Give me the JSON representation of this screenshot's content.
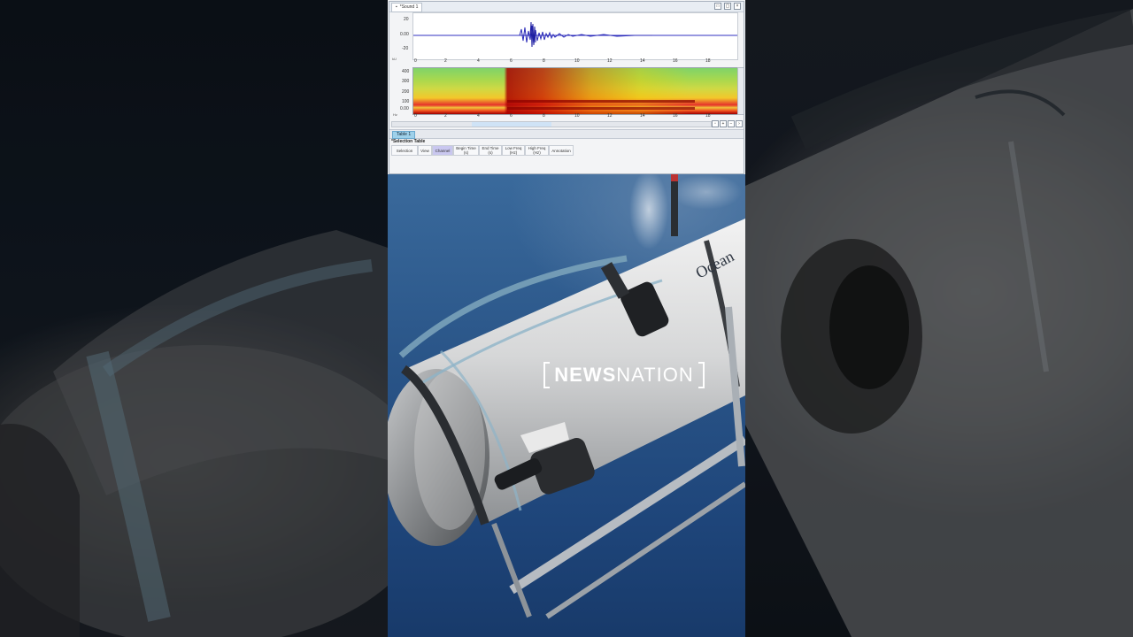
{
  "window": {
    "sound_tab": "*Sound 1",
    "buttons": [
      "□",
      "▢",
      "×"
    ]
  },
  "waveform": {
    "y_ticks": [
      "20",
      "0.00",
      "-20"
    ],
    "y_unit": "kU",
    "x_ticks": [
      "0",
      "2",
      "4",
      "6",
      "8",
      "10",
      "12",
      "14",
      "16",
      "18"
    ]
  },
  "spectrogram": {
    "y_ticks": [
      "400",
      "300",
      "200",
      "100",
      "0.00"
    ],
    "y_unit": "Hz",
    "x_ticks": [
      "0",
      "2",
      "4",
      "6",
      "8",
      "10",
      "12",
      "14",
      "16",
      "18"
    ]
  },
  "table_tab": "Table 1",
  "selection_table": {
    "title": "*Selection Table",
    "columns": [
      "Selection",
      "View",
      "Channel",
      "Begin Time (s)",
      "End Time (s)",
      "Low Freq (Hz)",
      "High Freq (Hz)",
      "Annotation"
    ]
  },
  "branding": {
    "news": "NEWS",
    "nation": "NATION",
    "hull_text": "Ocean"
  }
}
